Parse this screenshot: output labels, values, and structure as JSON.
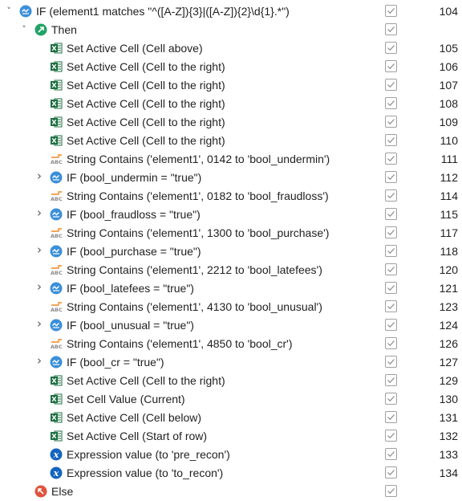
{
  "rows": [
    {
      "depth": 0,
      "chevron": "expanded",
      "icon": "if",
      "label": "IF (element1 matches \"^([A-Z]){3}|([A-Z]){2}\\d{1}.*\")",
      "checked": true,
      "line": "104"
    },
    {
      "depth": 1,
      "chevron": "expanded",
      "icon": "then",
      "label": "Then",
      "checked": true,
      "line": ""
    },
    {
      "depth": 2,
      "chevron": "none",
      "icon": "excel",
      "label": "Set Active Cell (Cell above)",
      "checked": true,
      "line": "105"
    },
    {
      "depth": 2,
      "chevron": "none",
      "icon": "excel",
      "label": "Set Active Cell (Cell to the right)",
      "checked": true,
      "line": "106"
    },
    {
      "depth": 2,
      "chevron": "none",
      "icon": "excel",
      "label": "Set Active Cell (Cell to the right)",
      "checked": true,
      "line": "107"
    },
    {
      "depth": 2,
      "chevron": "none",
      "icon": "excel",
      "label": "Set Active Cell (Cell to the right)",
      "checked": true,
      "line": "108"
    },
    {
      "depth": 2,
      "chevron": "none",
      "icon": "excel",
      "label": "Set Active Cell (Cell to the right)",
      "checked": true,
      "line": "109"
    },
    {
      "depth": 2,
      "chevron": "none",
      "icon": "excel",
      "label": "Set Active Cell (Cell to the right)",
      "checked": true,
      "line": "110"
    },
    {
      "depth": 2,
      "chevron": "none",
      "icon": "string",
      "label": "String Contains ('element1', 0142 to 'bool_undermin')",
      "checked": true,
      "line": "111"
    },
    {
      "depth": 2,
      "chevron": "collapsed",
      "icon": "if",
      "label": "IF (bool_undermin = \"true\")",
      "checked": true,
      "line": "112"
    },
    {
      "depth": 2,
      "chevron": "none",
      "icon": "string",
      "label": "String Contains ('element1', 0182 to 'bool_fraudloss')",
      "checked": true,
      "line": "114"
    },
    {
      "depth": 2,
      "chevron": "collapsed",
      "icon": "if",
      "label": "IF (bool_fraudloss = \"true\")",
      "checked": true,
      "line": "115"
    },
    {
      "depth": 2,
      "chevron": "none",
      "icon": "string",
      "label": "String Contains ('element1', 1300 to 'bool_purchase')",
      "checked": true,
      "line": "117"
    },
    {
      "depth": 2,
      "chevron": "collapsed",
      "icon": "if",
      "label": "IF (bool_purchase = \"true\")",
      "checked": true,
      "line": "118"
    },
    {
      "depth": 2,
      "chevron": "none",
      "icon": "string",
      "label": "String Contains ('element1', 2212 to 'bool_latefees')",
      "checked": true,
      "line": "120"
    },
    {
      "depth": 2,
      "chevron": "collapsed",
      "icon": "if",
      "label": "IF (bool_latefees = \"true\")",
      "checked": true,
      "line": "121"
    },
    {
      "depth": 2,
      "chevron": "none",
      "icon": "string",
      "label": "String Contains ('element1', 4130 to 'bool_unusual')",
      "checked": true,
      "line": "123"
    },
    {
      "depth": 2,
      "chevron": "collapsed",
      "icon": "if",
      "label": "IF (bool_unusual = \"true\")",
      "checked": true,
      "line": "124"
    },
    {
      "depth": 2,
      "chevron": "none",
      "icon": "string",
      "label": "String Contains ('element1', 4850 to 'bool_cr')",
      "checked": true,
      "line": "126"
    },
    {
      "depth": 2,
      "chevron": "collapsed",
      "icon": "if",
      "label": "IF (bool_cr = \"true\")",
      "checked": true,
      "line": "127"
    },
    {
      "depth": 2,
      "chevron": "none",
      "icon": "excel",
      "label": "Set Active Cell (Cell to the right)",
      "checked": true,
      "line": "129"
    },
    {
      "depth": 2,
      "chevron": "none",
      "icon": "excel",
      "label": "Set Cell Value (Current)",
      "checked": true,
      "line": "130"
    },
    {
      "depth": 2,
      "chevron": "none",
      "icon": "excel",
      "label": "Set Active Cell (Cell below)",
      "checked": true,
      "line": "131"
    },
    {
      "depth": 2,
      "chevron": "none",
      "icon": "excel",
      "label": "Set Active Cell (Start of row)",
      "checked": true,
      "line": "132"
    },
    {
      "depth": 2,
      "chevron": "none",
      "icon": "expression",
      "label": "Expression value (to 'pre_recon')",
      "checked": true,
      "line": "133"
    },
    {
      "depth": 2,
      "chevron": "none",
      "icon": "expression",
      "label": "Expression value (to 'to_recon')",
      "checked": true,
      "line": "134"
    },
    {
      "depth": 1,
      "chevron": "none",
      "icon": "else",
      "label": "Else",
      "checked": true,
      "line": ""
    }
  ],
  "icon_names": {
    "if": "if-condition-icon",
    "then": "then-branch-icon",
    "else": "else-branch-icon",
    "excel": "excel-icon",
    "string": "string-abc-icon",
    "expression": "expression-x-icon"
  },
  "colors": {
    "if_blue": "#3b8fd9",
    "then_green": "#21a366",
    "else_red": "#e0533d",
    "excel_green": "#1d6f42",
    "expression_blue": "#1565c0",
    "string_orange": "#f08a24"
  }
}
